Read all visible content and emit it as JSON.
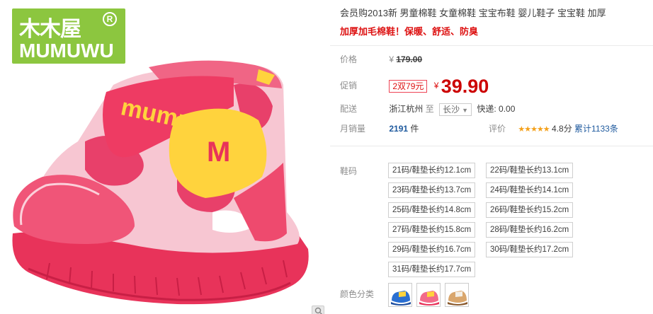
{
  "brand": {
    "logo_cn": "木木屋",
    "logo_en": "MUMUWU",
    "logo_reg": "R",
    "shoe_label": "mumuwu",
    "shoe_letter": "M"
  },
  "product": {
    "title": "会员购2013新 男童棉鞋 女童棉鞋 宝宝布鞋 婴儿鞋子 宝宝鞋 加厚",
    "subtitle": "加厚加毛棉鞋！保暖、舒适、防臭"
  },
  "price": {
    "label": "价格",
    "currency": "¥",
    "original": "179.00"
  },
  "promo": {
    "label": "促销",
    "badge": "2双79元",
    "currency": "¥",
    "price": "39.90"
  },
  "shipping": {
    "label": "配送",
    "from": "浙江杭州",
    "to_word": "至",
    "destination": "长沙",
    "fee_label": "快递:",
    "fee": "0.00"
  },
  "sales": {
    "label": "月销量",
    "count": "2191",
    "unit": "件",
    "rating_label": "评价",
    "stars": "★★★★★",
    "score": "4.8分",
    "reviews": "累计1133条"
  },
  "sizes": {
    "label": "鞋码",
    "options": [
      "21码/鞋垫长约12.1cm",
      "22码/鞋垫长约13.1cm",
      "23码/鞋垫长约13.7cm",
      "24码/鞋垫长约14.1cm",
      "25码/鞋垫长约14.8cm",
      "26码/鞋垫长约15.2cm",
      "27码/鞋垫长约15.8cm",
      "28码/鞋垫长约16.2cm",
      "29码/鞋垫长约16.7cm",
      "30码/鞋垫长约17.2cm",
      "31码/鞋垫长约17.7cm"
    ]
  },
  "colors": {
    "label": "颜色分类",
    "swatches": [
      "blue-yellow",
      "pink-red",
      "tan-brown"
    ]
  },
  "theme": {
    "accent_red": "#cc0000",
    "link_blue": "#1f5a9e",
    "logo_green": "#8cc63f",
    "star_orange": "#f4a11c"
  }
}
